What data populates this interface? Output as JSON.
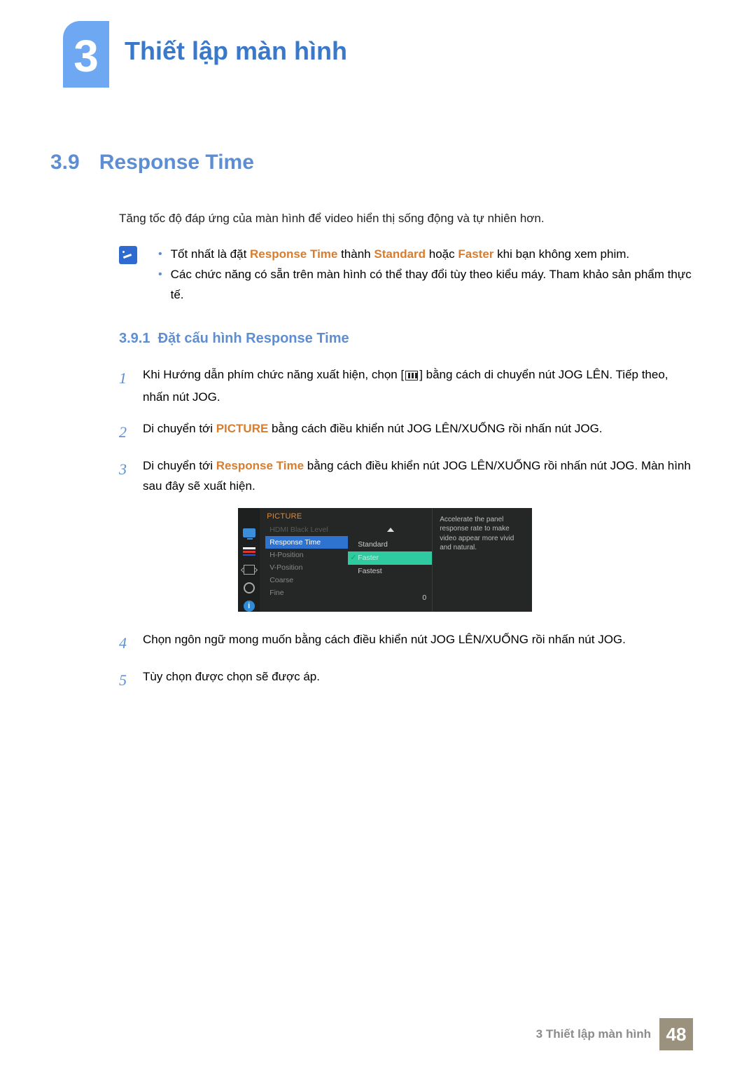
{
  "chapter": {
    "number": "3",
    "title": "Thiết lập màn hình"
  },
  "section": {
    "number": "3.9",
    "title": "Response Time"
  },
  "intro": "Tăng tốc độ đáp ứng của màn hình để video hiển thị sống động và tự nhiên hơn.",
  "notes": {
    "item1": {
      "pre": "Tốt nhất là đặt ",
      "hl1": "Response Time",
      "mid": " thành ",
      "hl2": "Standard",
      "mid2": " hoặc ",
      "hl3": "Faster",
      "post": " khi bạn không xem phim."
    },
    "item2": "Các chức năng có sẵn trên màn hình có thể thay đổi tùy theo kiểu máy. Tham khảo sản phẩm thực tế."
  },
  "subsection": {
    "number": "3.9.1",
    "title": "Đặt cấu hình Response Time"
  },
  "steps": {
    "s1": {
      "no": "1",
      "pre": "Khi Hướng dẫn phím chức năng xuất hiện, chọn [",
      "post": "] bằng cách di chuyển nút JOG LÊN. Tiếp theo, nhấn nút JOG."
    },
    "s2": {
      "no": "2",
      "pre": "Di chuyển tới ",
      "hl": "PICTURE",
      "post": " bằng cách điều khiển nút JOG LÊN/XUỐNG rồi nhấn nút JOG."
    },
    "s3": {
      "no": "3",
      "pre": "Di chuyển tới ",
      "hl": "Response Time",
      "post": " bằng cách điều khiển nút JOG LÊN/XUỐNG rồi nhấn nút JOG. Màn hình sau đây sẽ xuất hiện."
    },
    "s4": {
      "no": "4",
      "text": "Chọn ngôn ngữ mong muốn bằng cách điều khiển nút JOG LÊN/XUỐNG rồi nhấn nút JOG."
    },
    "s5": {
      "no": "5",
      "text": "Tùy chọn được chọn sẽ được áp."
    }
  },
  "osd": {
    "title": "PICTURE",
    "menu": {
      "hdmi": "HDMI Black Level",
      "rt": "Response Time",
      "hpos": "H-Position",
      "vpos": "V-Position",
      "coarse": "Coarse",
      "fine": "Fine",
      "fine_val": "0"
    },
    "options": {
      "o1": "Standard",
      "o2": "Faster",
      "o3": "Fastest"
    },
    "desc": "Accelerate the panel response rate to make video appear more vivid and natural."
  },
  "footer": {
    "text": "3 Thiết lập màn hình",
    "page": "48"
  }
}
